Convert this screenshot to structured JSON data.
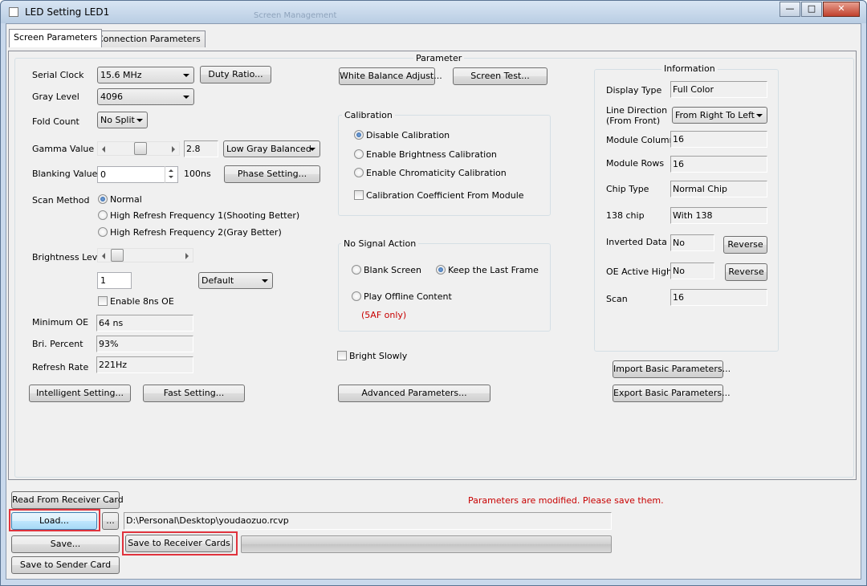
{
  "window": {
    "title": "LED Setting LED1",
    "ghost_title": "Screen Management",
    "min_glyph": "—",
    "max_glyph": "□",
    "close_glyph": "✕"
  },
  "tabs": [
    {
      "label": "Screen Parameters",
      "active": true
    },
    {
      "label": "Connection Parameters",
      "active": false
    }
  ],
  "parameter_title": "Parameter",
  "left": {
    "serial_clock_label": "Serial Clock",
    "serial_clock_value": "15.6 MHz",
    "duty_ratio_button": "Duty Ratio...",
    "gray_level_label": "Gray Level",
    "gray_level_value": "4096",
    "fold_count_label": "Fold Count",
    "fold_count_value": "No Split",
    "gamma_label": "Gamma Value",
    "gamma_value": "2.8",
    "gamma_slider_fraction": 0.55,
    "gamma_mode_value": "Low Gray Balanced",
    "blanking_label": "Blanking Value",
    "blanking_value": "0",
    "blanking_unit": "100ns",
    "phase_setting_button": "Phase Setting...",
    "scan_method_label": "Scan Method",
    "scan_options": [
      {
        "label": "Normal",
        "checked": true
      },
      {
        "label": "High Refresh Frequency 1(Shooting Better)",
        "checked": false
      },
      {
        "label": "High Refresh Frequency 2(Gray Better)",
        "checked": false
      }
    ],
    "brightness_label": "Brightness Level",
    "brightness_slider_fraction": 0.0,
    "brightness_value": "1",
    "brightness_mode_value": "Default",
    "enable_8ns_label": "Enable 8ns OE",
    "enable_8ns_checked": false,
    "min_oe_label": "Minimum OE",
    "min_oe_value": "64 ns",
    "bri_percent_label": "Bri. Percent",
    "bri_percent_value": "93%",
    "refresh_rate_label": "Refresh Rate",
    "refresh_rate_value": "221Hz",
    "intelligent_button": "Intelligent Setting...",
    "fast_button": "Fast Setting..."
  },
  "middle": {
    "white_balance_button": "White Balance Adjust...",
    "screen_test_button": "Screen Test...",
    "calibration_title": "Calibration",
    "calibration_options": [
      {
        "label": "Disable Calibration",
        "checked": true
      },
      {
        "label": "Enable Brightness Calibration",
        "checked": false
      },
      {
        "label": "Enable Chromaticity Calibration",
        "checked": false
      }
    ],
    "calib_coeff_label": "Calibration Coefficient From Module",
    "no_signal_title": "No Signal Action",
    "blank_screen_label": "Blank Screen",
    "keep_last_label": "Keep the Last Frame",
    "play_offline_label": "Play Offline Content",
    "only_5af": "(5AF only)",
    "bright_slowly_label": "Bright Slowly",
    "advanced_button": "Advanced Parameters..."
  },
  "info": {
    "title": "Information",
    "display_type_label": "Display Type",
    "display_type_value": "Full Color",
    "line_direction_label1": "Line Direction",
    "line_direction_label2": "(From Front)",
    "line_direction_value": "From Right To Left",
    "module_columns_label": "Module Columns",
    "module_columns_value": "16",
    "module_rows_label": "Module Rows",
    "module_rows_value": "16",
    "chip_type_label": "Chip Type",
    "chip_type_value": "Normal Chip",
    "chip138_label": "138 chip",
    "chip138_value": "With 138",
    "inverted_label": "Inverted Data",
    "inverted_value": "No",
    "reverse_button": "Reverse",
    "oe_label": "OE Active High",
    "oe_value": "No",
    "scan_label": "Scan",
    "scan_value": "16",
    "import_button": "Import Basic Parameters...",
    "export_button": "Export Basic Parameters..."
  },
  "bottom": {
    "read_button": "Read From Receiver Card",
    "status_message": "Parameters are modified. Please save them.",
    "load_button": "Load...",
    "browse_button": "...",
    "file_path": "D:\\Personal\\Desktop\\youdaozuo.rcvp",
    "save_button": "Save...",
    "save_receiver_button": "Save to Receiver Cards",
    "save_sender_button": "Save to Sender Card"
  },
  "colors": {
    "highlight_border": "#e0333d",
    "warning_text": "#c80000"
  }
}
